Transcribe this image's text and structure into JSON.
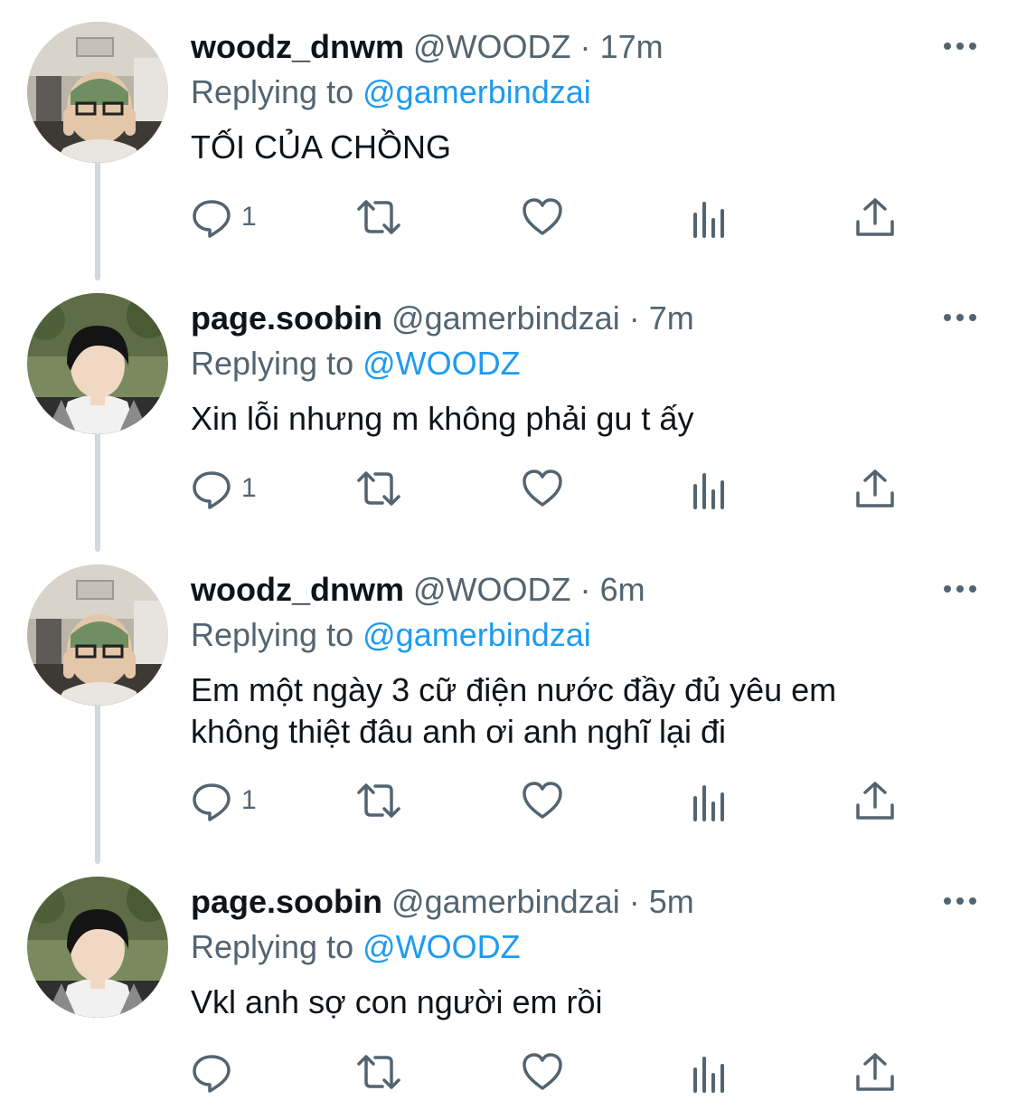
{
  "colors": {
    "link": "#1d9bf0",
    "muted": "#536471",
    "text": "#0f1419",
    "thread_line": "#cfd9de"
  },
  "tweets": [
    {
      "name": "woodz_dnwm",
      "handle": "@WOODZ",
      "dot": "·",
      "time": "17m",
      "replying_prefix": "Replying to",
      "replying_to": "@gamerbindzai",
      "text": "TỐI CỦA CHỒNG",
      "reply_count": "1",
      "avatar": "woodz-avatar"
    },
    {
      "name": "page.soobin",
      "handle": "@gamerbindzai",
      "dot": "·",
      "time": "7m",
      "replying_prefix": "Replying to",
      "replying_to": "@WOODZ",
      "text": "Xin lỗi nhưng m không phải gu t ấy",
      "reply_count": "1",
      "avatar": "soobin-avatar"
    },
    {
      "name": "woodz_dnwm",
      "handle": "@WOODZ",
      "dot": "·",
      "time": "6m",
      "replying_prefix": "Replying to",
      "replying_to": "@gamerbindzai",
      "text_line1": "Em một ngày 3 cữ điện nước đầy đủ yêu em",
      "text_line2": "không thiệt đâu anh ơi anh nghĩ lại đi",
      "reply_count": "1",
      "avatar": "woodz-avatar"
    },
    {
      "name": "page.soobin",
      "handle": "@gamerbindzai",
      "dot": "·",
      "time": "5m",
      "replying_prefix": "Replying to",
      "replying_to": "@WOODZ",
      "text": "Vkl anh sợ con người em rồi",
      "reply_count": "",
      "avatar": "soobin-avatar"
    }
  ],
  "icons": [
    "more-icon",
    "reply-icon",
    "retweet-icon",
    "like-icon",
    "views-icon",
    "share-icon"
  ]
}
